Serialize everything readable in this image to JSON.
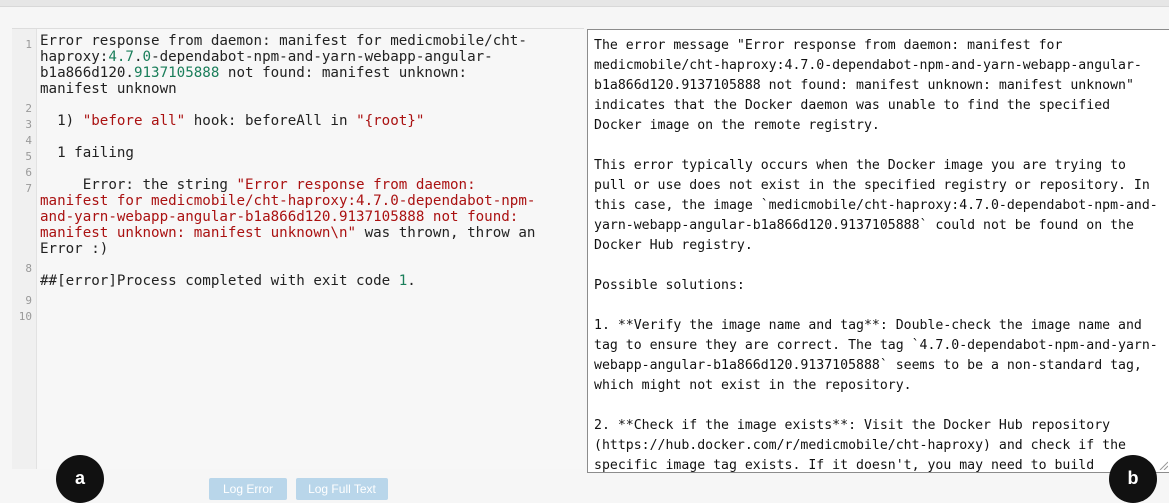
{
  "editor": {
    "line_numbers": [
      "1",
      "2",
      "3",
      "4",
      "5",
      "6",
      "7",
      "8",
      "9",
      "10"
    ],
    "lines": [
      [
        {
          "t": "Error response from daemon: manifest for medicmobile/cht-"
        }
      ],
      [
        {
          "t": "haproxy:"
        },
        {
          "t": "4.7",
          "c": "num"
        },
        {
          "t": "."
        },
        {
          "t": "0",
          "c": "num"
        },
        {
          "t": "-dependabot-npm-and-yarn-webapp-angular-"
        }
      ],
      [
        {
          "t": "b1a866d120."
        },
        {
          "t": "9137105888",
          "c": "num"
        },
        {
          "t": " not found: manifest unknown:"
        }
      ],
      [
        {
          "t": "manifest unknown"
        }
      ],
      [
        {
          "t": ""
        }
      ],
      [
        {
          "t": "  1) "
        },
        {
          "t": "\"before all\"",
          "c": "str"
        },
        {
          "t": " hook: beforeAll in "
        },
        {
          "t": "\"{root}\"",
          "c": "str"
        }
      ],
      [
        {
          "t": ""
        }
      ],
      [
        {
          "t": "  1 failing"
        }
      ],
      [
        {
          "t": ""
        }
      ],
      [
        {
          "t": "     Error: the string "
        },
        {
          "t": "\"Error response from daemon:",
          "c": "str"
        }
      ],
      [
        {
          "t": "manifest for medicmobile/cht-haproxy:4.7.0-dependabot-npm-",
          "c": "str"
        }
      ],
      [
        {
          "t": "and-yarn-webapp-angular-b1a866d120.9137105888 not found:",
          "c": "str"
        }
      ],
      [
        {
          "t": "manifest unknown: manifest unknown\\n\"",
          "c": "str"
        },
        {
          "t": " was thrown, throw an"
        }
      ],
      [
        {
          "t": "Error :)"
        }
      ],
      [
        {
          "t": ""
        }
      ],
      [
        {
          "t": "##[error]Process completed with exit code "
        },
        {
          "t": "1",
          "c": "num"
        },
        {
          "t": "."
        }
      ]
    ]
  },
  "response": {
    "lines": [
      "The error message \"Error response from daemon: manifest for",
      "medicmobile/cht-haproxy:4.7.0-dependabot-npm-and-yarn-webapp-angular-",
      "b1a866d120.9137105888 not found: manifest unknown: manifest unknown\"",
      "indicates that the Docker daemon was unable to find the specified",
      "Docker image on the remote registry.",
      "",
      "This error typically occurs when the Docker image you are trying to",
      "pull or use does not exist in the specified registry or repository. In",
      "this case, the image `medicmobile/cht-haproxy:4.7.0-dependabot-npm-and-",
      "yarn-webapp-angular-b1a866d120.9137105888` could not be found on the",
      "Docker Hub registry.",
      "",
      "Possible solutions:",
      "",
      "1. **Verify the image name and tag**: Double-check the image name and",
      "tag to ensure they are correct. The tag `4.7.0-dependabot-npm-and-yarn-",
      "webapp-angular-b1a866d120.9137105888` seems to be a non-standard tag,",
      "which might not exist in the repository.",
      "",
      "2. **Check if the image exists**: Visit the Docker Hub repository",
      "(https://hub.docker.com/r/medicmobile/cht-haproxy) and check if the",
      "specific image tag exists. If it doesn't, you may need to build"
    ]
  },
  "buttons": {
    "log_error": "Log Error",
    "log_full_text": "Log Full Text"
  },
  "markers": {
    "a": "a",
    "b": "b"
  }
}
